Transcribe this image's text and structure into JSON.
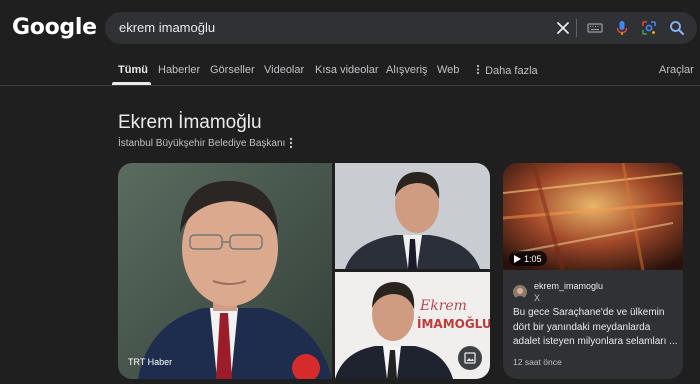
{
  "logo": "Google",
  "search": {
    "query": "ekrem imamoğlu"
  },
  "tabs": [
    {
      "label": "Tümü",
      "active": true
    },
    {
      "label": "Haberler"
    },
    {
      "label": "Görseller"
    },
    {
      "label": "Videolar"
    },
    {
      "label": "Kısa videolar"
    },
    {
      "label": "Alışveriş"
    },
    {
      "label": "Web"
    },
    {
      "label": "Daha fazla"
    }
  ],
  "tools_label": "Araçlar",
  "knowledge_panel": {
    "title": "Ekrem İmamoğlu",
    "subtitle": "İstanbul Büyükşehir Belediye Başkanı",
    "main_image_source": "TRT Haber"
  },
  "social_card": {
    "video_duration": "1:05",
    "handle": "ekrem_imamoglu",
    "platform": "X",
    "text": "Bu gece Saraçhane'de ve ülkemin dört bir yanındaki meydanlarda adalet isteyen milyonlara selamları ...",
    "time": "12 saat önce"
  },
  "colors": {
    "background": "#1f1f1f",
    "searchbox": "#303134",
    "text": "#e8eaed",
    "muted_text": "#bdc1c6",
    "mic_blue": "#4285f4",
    "search_icon": "#8ab4f8"
  },
  "icons": [
    "clear-icon",
    "keyboard-icon",
    "mic-icon",
    "lens-icon",
    "search-icon",
    "more-vert-icon",
    "gallery-icon",
    "play-icon"
  ]
}
